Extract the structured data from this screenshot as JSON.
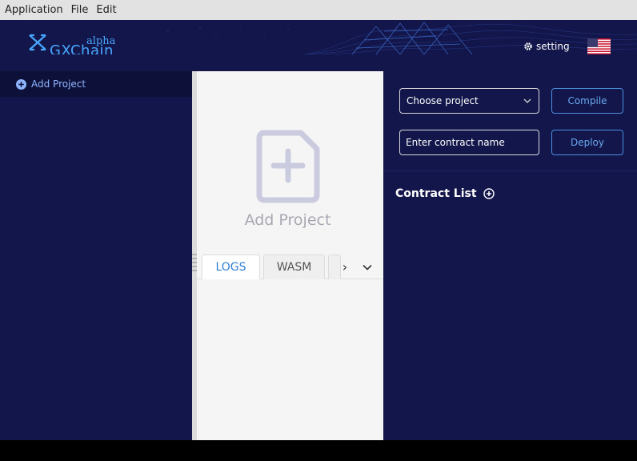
{
  "menu": [
    "Application",
    "File",
    "Edit"
  ],
  "header": {
    "logo_alpha": "alpha",
    "logo_name": "GXChain",
    "setting_label": "setting",
    "language_flag": "us-flag-icon"
  },
  "sidebar": {
    "add_project_label": "Add Project"
  },
  "center": {
    "add_project_label": "Add Project",
    "tabs": [
      "LOGS",
      "WASM"
    ],
    "active_tab": "LOGS"
  },
  "right": {
    "project_select_placeholder": "Choose project",
    "contract_name_placeholder": "Enter contract name",
    "compile_label": "Compile",
    "deploy_label": "Deploy",
    "contract_list_title": "Contract List"
  },
  "colors": {
    "navy": "#12164a",
    "accent": "#49a6ff",
    "tab_active": "#2f7fd6"
  }
}
